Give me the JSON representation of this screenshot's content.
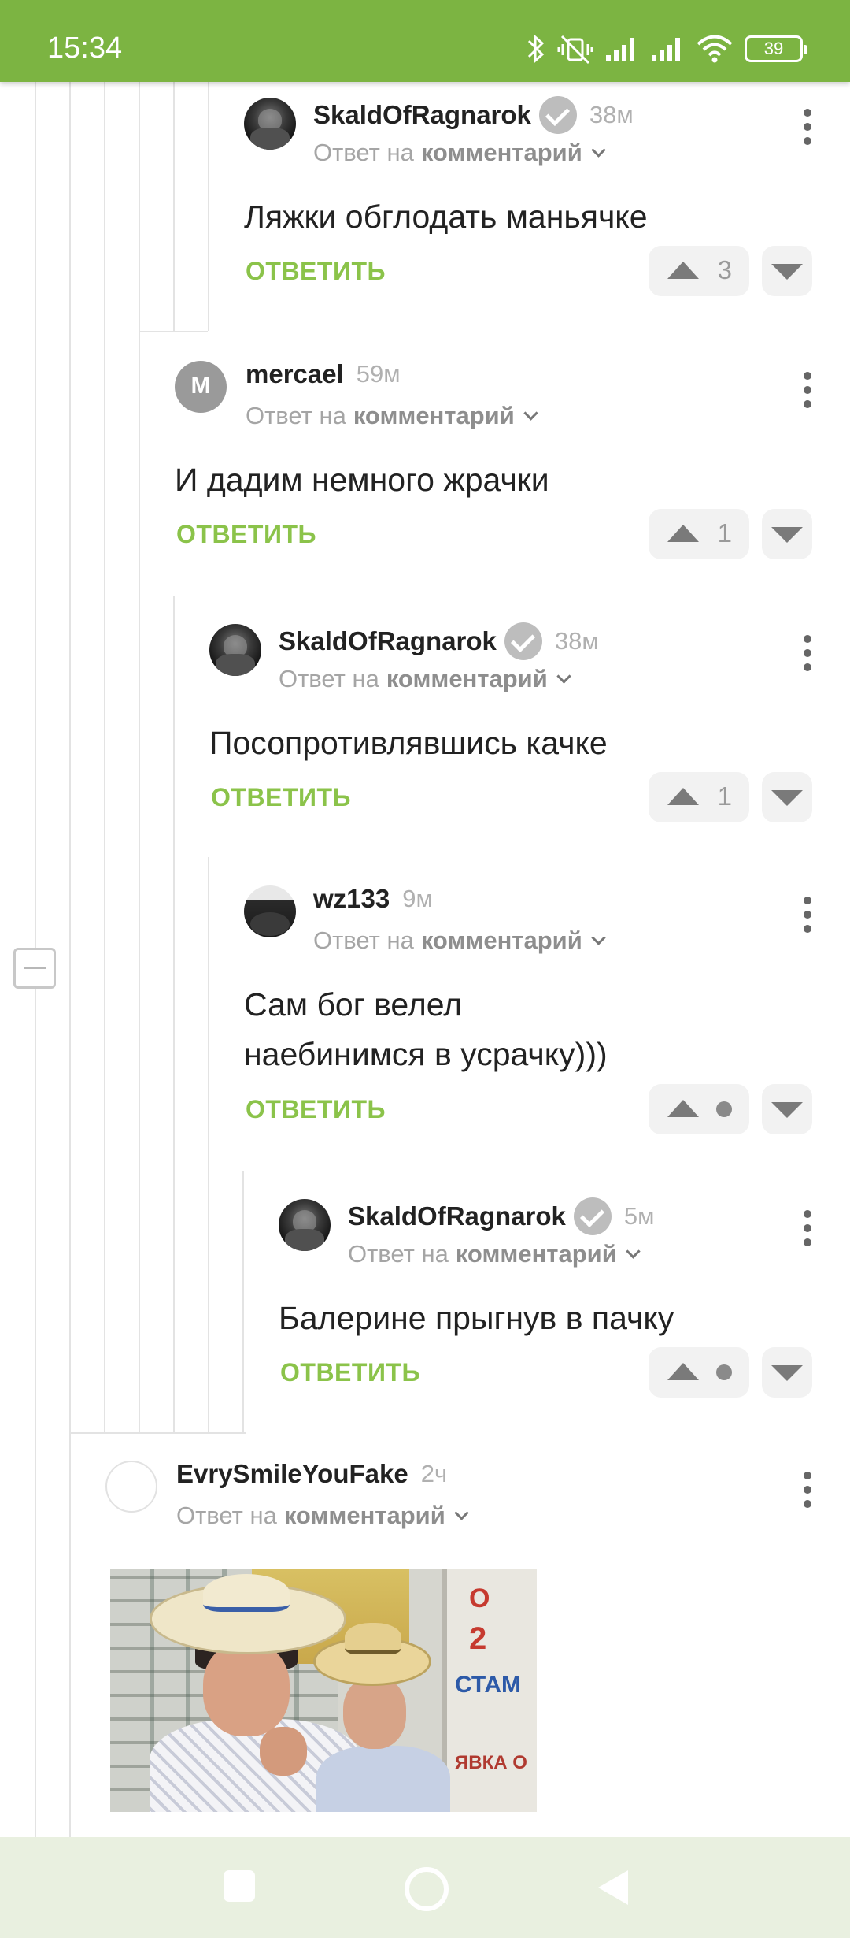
{
  "status_bar": {
    "time": "15:34",
    "battery": "39",
    "icons": [
      "bluetooth-icon",
      "mute-vibrate-icon",
      "signal-icon",
      "signal-icon",
      "wifi-icon",
      "battery-icon"
    ]
  },
  "colors": {
    "brand_green": "#7cb442",
    "reply_green": "#8bc34a",
    "thread_line": "#e3e3e3"
  },
  "comments": [
    {
      "author": "SkaldOfRagnarok",
      "verified": true,
      "age": "38м",
      "reply_to_prefix": "Ответ на",
      "reply_to_link": "комментарий",
      "text": "Ляжки обглодать маньячке",
      "reply_label": "ОТВЕТИТЬ",
      "rating": "3"
    },
    {
      "author": "mercael",
      "verified": false,
      "age": "59м",
      "reply_to_prefix": "Ответ на",
      "reply_to_link": "комментарий",
      "text": "И дадим немного жрачки",
      "reply_label": "ОТВЕТИТЬ",
      "rating": "1"
    },
    {
      "author": "SkaldOfRagnarok",
      "verified": true,
      "age": "38м",
      "reply_to_prefix": "Ответ на",
      "reply_to_link": "комментарий",
      "text": "Посопротивлявшись качке",
      "reply_label": "ОТВЕТИТЬ",
      "rating": "1"
    },
    {
      "author": "wz133",
      "verified": false,
      "age": "9м",
      "reply_to_prefix": "Ответ на",
      "reply_to_link": "комментарий",
      "text_lines": [
        "Сам бог велел",
        "наебинимся в усрачку)))"
      ],
      "reply_label": "ОТВЕТИТЬ",
      "rating": null
    },
    {
      "author": "SkaldOfRagnarok",
      "verified": true,
      "age": "5м",
      "reply_to_prefix": "Ответ на",
      "reply_to_link": "комментарий",
      "text": "Балерине прыгнув в пачку",
      "reply_label": "ОТВЕТИТЬ",
      "rating": null
    },
    {
      "author": "EvrySmileYouFake",
      "verified": false,
      "age": "2ч",
      "reply_to_prefix": "Ответ на",
      "reply_to_link": "комментарий",
      "image": {
        "poster_text": [
          "О",
          "2",
          "СТАМ",
          "ЯВКА О"
        ]
      }
    }
  ],
  "nav": {
    "icons": [
      "recents-square-icon",
      "home-circle-icon",
      "back-triangle-icon"
    ]
  }
}
